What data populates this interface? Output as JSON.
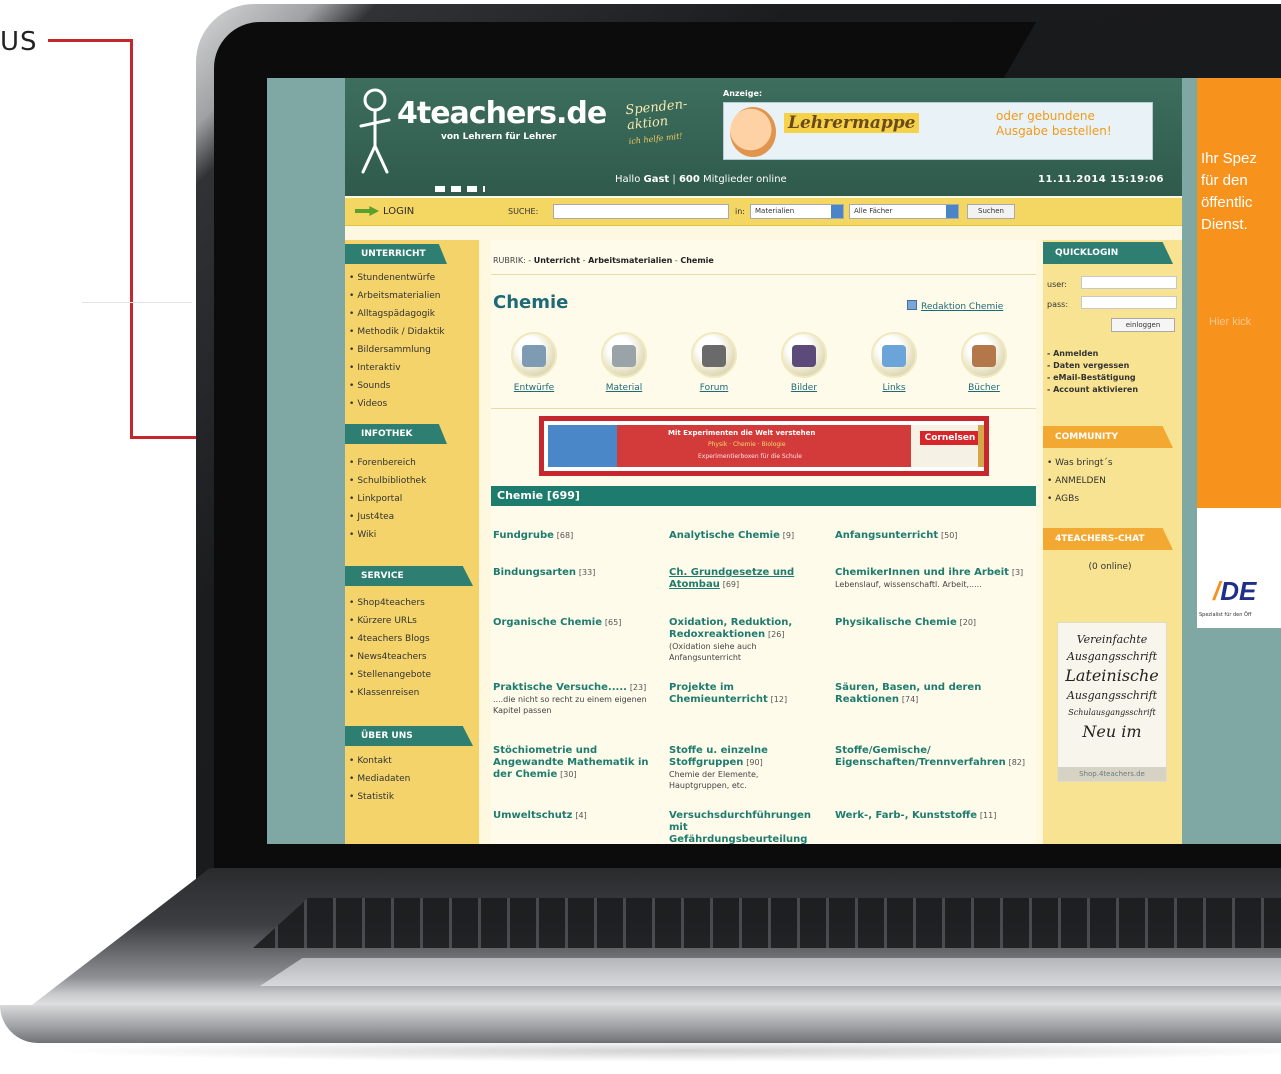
{
  "annotation": {
    "label": "US"
  },
  "header": {
    "logo_main": "4teachers.de",
    "logo_sub": "von Lehrern für Lehrer",
    "spende_1": "Spenden-",
    "spende_2": "aktion",
    "spende_3": "ich helfe mit!",
    "ad_label": "Anzeige:",
    "banner_title": "Lehrermappe",
    "banner_cta_1": "oder gebundene",
    "banner_cta_2": "Ausgabe bestellen!",
    "greeting_pre": "Hallo ",
    "greeting_user": "Gast",
    "greeting_sep": " | ",
    "members_count": "600",
    "members_suffix": " Mitglieder online",
    "datetime": "11.11.2014 15:19:06"
  },
  "searchbar": {
    "login": "LOGIN",
    "suche_label": "SUCHE:",
    "suche_value": "",
    "in_label": "in:",
    "select_area": "Materialien",
    "select_subject": "Alle Fächer",
    "search_button": "Suchen"
  },
  "left": {
    "unterricht": {
      "title": "UNTERRICHT",
      "items": [
        "Stundenentwürfe",
        "Arbeitsmaterialien",
        "Alltagspädagogik",
        "Methodik / Didaktik",
        "Bildersammlung",
        "Interaktiv",
        "Sounds",
        "Videos"
      ]
    },
    "infothek": {
      "title": "INFOTHEK",
      "items": [
        "Forenbereich",
        "Schulbibliothek",
        "Linkportal",
        "Just4tea",
        "Wiki"
      ]
    },
    "service": {
      "title": "SERVICE",
      "items": [
        "Shop4teachers",
        "Kürzere URLs",
        "4teachers Blogs",
        "News4teachers",
        "Stellenangebote",
        "Klassenreisen"
      ]
    },
    "ueber": {
      "title": "ÜBER UNS",
      "items": [
        "Kontakt",
        "Mediadaten",
        "Statistik"
      ]
    }
  },
  "main": {
    "crumb_prefix": "RUBRIK: - ",
    "crumb_1": "Unterricht",
    "crumb_sep": " - ",
    "crumb_2": "Arbeitsmaterialien",
    "crumb_3": "Chemie",
    "title": "Chemie",
    "redaktion": "Redaktion Chemie",
    "categories": [
      {
        "label": "Entwürfe",
        "color": "#7f9bb3"
      },
      {
        "label": "Material",
        "color": "#9aa3a8"
      },
      {
        "label": "Forum",
        "color": "#6a6a6a"
      },
      {
        "label": "Bilder",
        "color": "#5b4a7a"
      },
      {
        "label": "Links",
        "color": "#6ba4d8"
      },
      {
        "label": "Bücher",
        "color": "#b3774a"
      }
    ],
    "ad": {
      "line1": "Mit Experimenten die Welt verstehen",
      "line2": "Physik · Chemie · Biologie",
      "line3": "Experimentierboxen für die Schule",
      "brand": "Cornelsen"
    },
    "section": "Chemie [699]",
    "topics": [
      {
        "title": "Fundgrube",
        "count": "[68]",
        "desc": ""
      },
      {
        "title": "Analytische Chemie",
        "count": "[9]",
        "desc": ""
      },
      {
        "title": "Anfangsunterricht",
        "count": "[50]",
        "desc": ""
      },
      {
        "title": "Bindungsarten",
        "count": "[33]",
        "desc": ""
      },
      {
        "title": "Ch. Grundgesetze und Atombau",
        "count": "[69]",
        "desc": ""
      },
      {
        "title": "ChemikerInnen und ihre Arbeit",
        "count": "[3]",
        "desc": "Lebenslauf, wissenschaftl. Arbeit,....."
      },
      {
        "title": "Organische Chemie",
        "count": "[65]",
        "desc": ""
      },
      {
        "title": "Oxidation, Reduktion, Redoxreaktionen",
        "count": "[26]",
        "desc": "(Oxidation siehe auch Anfangsunterricht"
      },
      {
        "title": "Physikalische Chemie",
        "count": "[20]",
        "desc": ""
      },
      {
        "title": "Praktische Versuche.....",
        "count": "[23]",
        "desc": "....die nicht so recht zu einem eigenen Kapitel passen"
      },
      {
        "title": "Projekte im Chemieunterricht",
        "count": "[12]",
        "desc": ""
      },
      {
        "title": "Säuren, Basen, und deren Reaktionen",
        "count": "[74]",
        "desc": ""
      },
      {
        "title": "Stöchiometrie und Angewandte Mathematik in der Chemie",
        "count": "[30]",
        "desc": ""
      },
      {
        "title": "Stoffe u. einzelne Stoffgruppen",
        "count": "[90]",
        "desc": "Chemie der Elemente, Hauptgruppen, etc."
      },
      {
        "title": "Stoffe/Gemische/ Eigenschaften/Trennverfahren",
        "count": "[82]",
        "desc": ""
      },
      {
        "title": "Umweltschutz",
        "count": "[4]",
        "desc": ""
      },
      {
        "title": "Versuchsdurchführungen mit Gefährdungsbeurteilung",
        "count": "",
        "desc": ""
      },
      {
        "title": "Werk-, Farb-, Kunststoffe",
        "count": "[11]",
        "desc": ""
      }
    ]
  },
  "right": {
    "quicklogin": "QUICKLOGIN",
    "user_label": "user:",
    "pass_label": "pass:",
    "login_button": "einloggen",
    "links": [
      "Anmelden",
      "Daten vergessen",
      "eMail-Bestätigung",
      "Account aktivieren"
    ],
    "community": "COMMUNITY",
    "community_items": [
      "Was bringt´s",
      "ANMELDEN",
      "AGBs"
    ],
    "chat": "4TEACHERS-CHAT",
    "chat_online": "(0 online)",
    "shop_ad": {
      "l1": "Vereinfachte",
      "l2": "Ausgangsschrift",
      "l3": "Lateinische",
      "l4": "Ausgangsschrift",
      "l5": "Schulausgangsschrift",
      "l6": "Neu im",
      "foot": "Shop.4teachers.de"
    }
  },
  "side_ad": {
    "line1": "Ihr Spez",
    "line2": "für den",
    "line3": "öffentlic",
    "line4": "Dienst.",
    "button": "Hier kick",
    "logo": "DE",
    "small": "Spezialist für den Öff"
  }
}
